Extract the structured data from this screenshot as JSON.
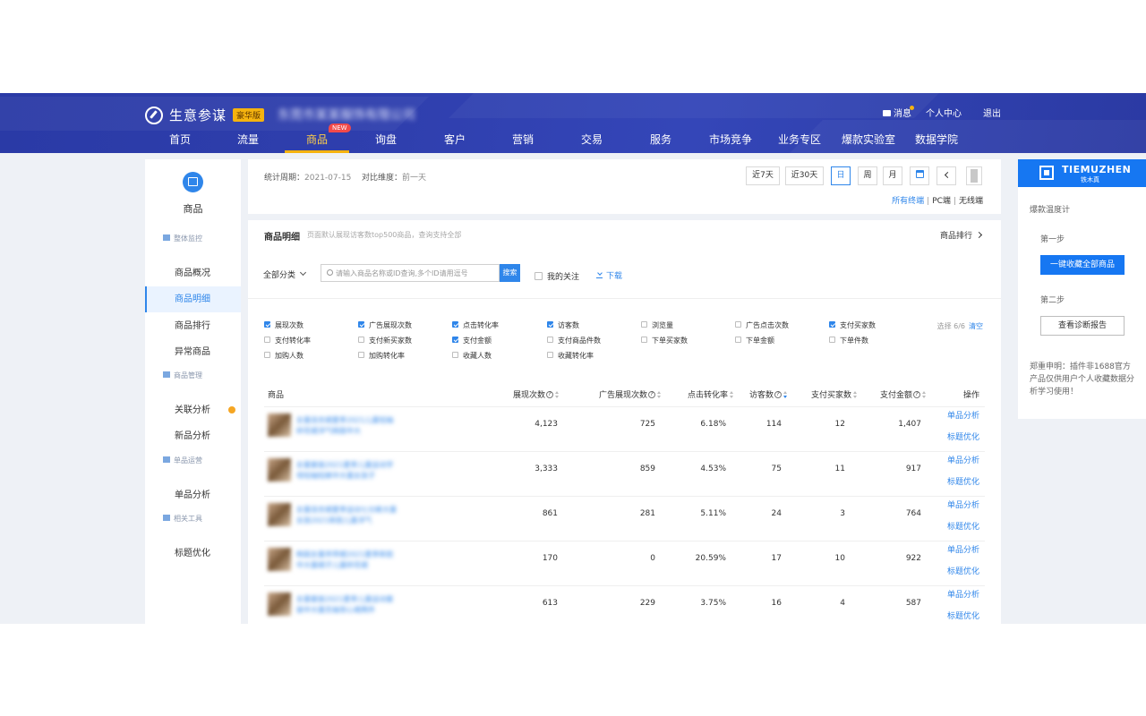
{
  "header": {
    "app_name": "生意参谋",
    "edition_badge": "豪华版",
    "company_name": "东莞市某某服饰有限公司",
    "messages": "消息",
    "personal_center": "个人中心",
    "logout": "退出",
    "nav": [
      {
        "label": "首页"
      },
      {
        "label": "流量"
      },
      {
        "label": "商品",
        "active": true,
        "badge": "NEW"
      },
      {
        "label": "询盘"
      },
      {
        "label": "客户"
      },
      {
        "label": "营销"
      },
      {
        "label": "交易"
      },
      {
        "label": "服务"
      },
      {
        "label": "市场竞争"
      },
      {
        "label": "业务专区"
      },
      {
        "label": "爆款实验室"
      },
      {
        "label": "数据学院"
      }
    ]
  },
  "sidebar": {
    "title": "商品",
    "groups": [
      {
        "label": "整体监控",
        "items": [
          "商品概况",
          "商品明细",
          "商品排行",
          "异常商品"
        ]
      },
      {
        "label": "商品管理",
        "items": [
          "关联分析",
          "新品分析"
        ]
      },
      {
        "label": "单品运营",
        "items": [
          "单品分析"
        ]
      },
      {
        "label": "相关工具",
        "items": [
          "标题优化"
        ]
      }
    ],
    "active_item": "商品明细"
  },
  "period": {
    "stat_label": "统计周期：",
    "stat_value": "2021-07-15",
    "compare_label": "对比维度：",
    "compare_value": "前一天",
    "buttons": [
      "近7天",
      "近30天",
      "日",
      "周",
      "月"
    ],
    "active_button": "日",
    "terminals": [
      "所有终端",
      "PC端",
      "无线端"
    ]
  },
  "detail": {
    "title": "商品明细",
    "subtitle": "页面默认展现访客数top500商品，查询支持全部",
    "rank_link": "商品排行",
    "category": "全部分类",
    "search_placeholder": "请输入商品名称或ID查询,多个ID请用逗号",
    "search_button": "搜索",
    "follow_label": "我的关注",
    "download_label": "下载",
    "selected_count": "选择 6/6",
    "clear": "清空",
    "metrics": [
      [
        {
          "label": "展现次数",
          "checked": true
        },
        {
          "label": "广告展现次数",
          "checked": true
        },
        {
          "label": "点击转化率",
          "checked": true
        },
        {
          "label": "访客数",
          "checked": true
        },
        {
          "label": "浏览量",
          "checked": false
        },
        {
          "label": "广告点击次数",
          "checked": false
        },
        {
          "label": "支付买家数",
          "checked": true
        }
      ],
      [
        {
          "label": "支付转化率",
          "checked": false
        },
        {
          "label": "支付新买家数",
          "checked": false
        },
        {
          "label": "支付金额",
          "checked": true
        },
        {
          "label": "支付商品件数",
          "checked": false
        },
        {
          "label": "下单买家数",
          "checked": false
        },
        {
          "label": "下单金额",
          "checked": false
        },
        {
          "label": "下单件数",
          "checked": false
        }
      ],
      [
        {
          "label": "加购人数",
          "checked": false
        },
        {
          "label": "加购转化率",
          "checked": false
        },
        {
          "label": "收藏人数",
          "checked": false
        },
        {
          "label": "收藏转化率",
          "checked": false
        }
      ]
    ],
    "columns": [
      "商品",
      "展现次数",
      "广告展现次数",
      "点击转化率",
      "访客数",
      "支付买家数",
      "支付金额",
      "操作"
    ],
    "rows": [
      {
        "name": "女童连衣裙夏季2021儿童短袖碎花裙洋气韩版中大",
        "impressions": "4,123",
        "ad_impressions": "725",
        "ctr": "6.18%",
        "visitors": "114",
        "buyers": "12",
        "amount": "1,407"
      },
      {
        "name": "女童套装2021夏季儿童运动字母短袖短裤中大童女孩子",
        "impressions": "3,333",
        "ad_impressions": "859",
        "ctr": "4.53%",
        "visitors": "75",
        "buyers": "11",
        "amount": "917"
      },
      {
        "name": "女童连衣裙夏季运动七分裤大童女孩2021新款儿童洋气",
        "impressions": "861",
        "ad_impressions": "281",
        "ctr": "5.11%",
        "visitors": "24",
        "buyers": "3",
        "amount": "764"
      },
      {
        "name": "韩版女童吊带裙2021夏季新款中大童裙子儿童碎花裙",
        "impressions": "170",
        "ad_impressions": "0",
        "ctr": "20.59%",
        "visitors": "17",
        "buyers": "10",
        "amount": "922"
      },
      {
        "name": "女童套装2021夏季儿童运动套装中大童无袖背心裙两件",
        "impressions": "613",
        "ad_impressions": "229",
        "ctr": "3.75%",
        "visitors": "16",
        "buyers": "4",
        "amount": "587"
      }
    ],
    "ops": [
      "单品分析",
      "标题优化"
    ]
  },
  "plugin": {
    "brand_en": "TIEMUZHEN",
    "brand_cn": "铁木真",
    "section": "爆款温度计",
    "step1": "第一步",
    "step1_button": "一键收藏全部商品",
    "step2": "第二步",
    "step2_button": "查看诊断报告",
    "notice": "郑重申明：插件非1688官方产品仅供用户个人收藏数据分析学习使用！"
  },
  "colors": {
    "header": "#2f3fae",
    "accent": "#2f86ea",
    "highlight": "#f5b30f",
    "plugin_blue": "#1677f2"
  }
}
